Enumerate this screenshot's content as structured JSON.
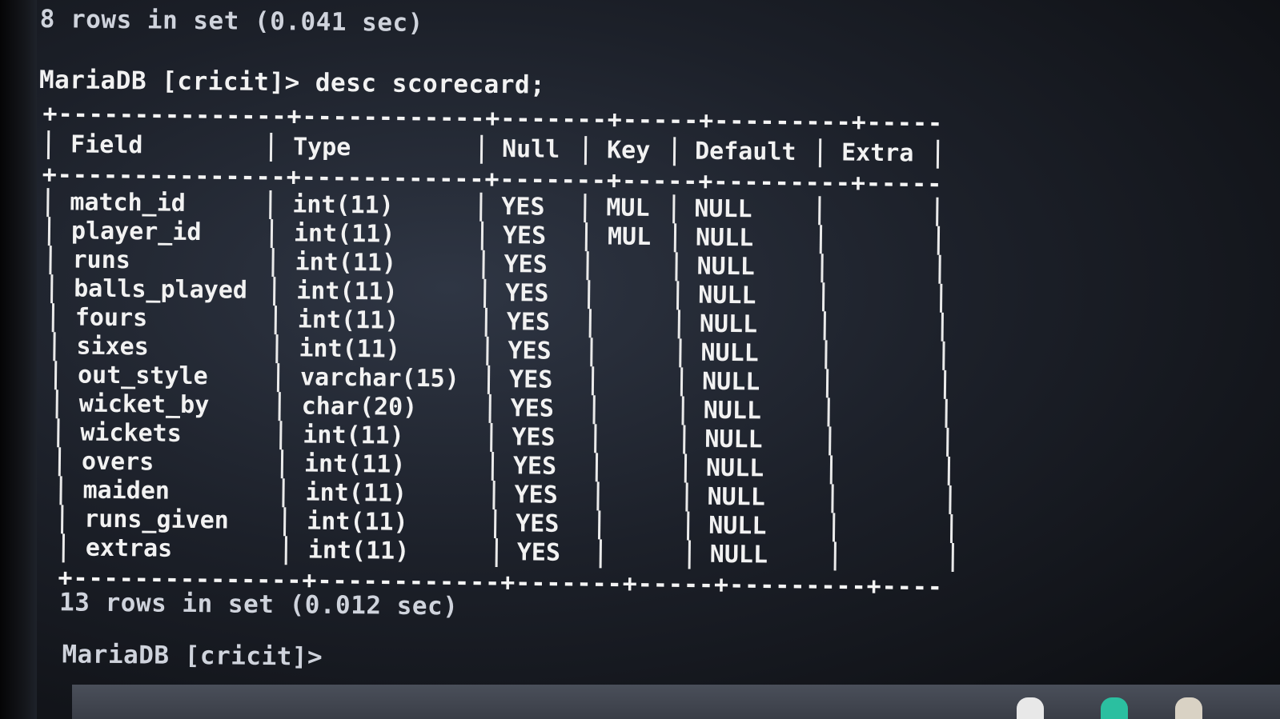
{
  "terminal": {
    "prev_result": "8 rows in set (0.041 sec)",
    "prompt_command": "MariaDB [cricit]> desc scorecard;",
    "border_line": "+---------------+------------+-------+-----+---------+-------+",
    "columns": [
      "Field",
      "Type",
      "Null",
      "Key",
      "Default",
      "Extra"
    ],
    "rows": [
      [
        "match_id",
        "int(11)",
        "YES",
        "MUL",
        "NULL",
        ""
      ],
      [
        "player_id",
        "int(11)",
        "YES",
        "MUL",
        "NULL",
        ""
      ],
      [
        "runs",
        "int(11)",
        "YES",
        "",
        "NULL",
        ""
      ],
      [
        "balls_played",
        "int(11)",
        "YES",
        "",
        "NULL",
        ""
      ],
      [
        "fours",
        "int(11)",
        "YES",
        "",
        "NULL",
        ""
      ],
      [
        "sixes",
        "int(11)",
        "YES",
        "",
        "NULL",
        ""
      ],
      [
        "out_style",
        "varchar(15)",
        "YES",
        "",
        "NULL",
        ""
      ],
      [
        "wicket_by",
        "char(20)",
        "YES",
        "",
        "NULL",
        ""
      ],
      [
        "wickets",
        "int(11)",
        "YES",
        "",
        "NULL",
        ""
      ],
      [
        "overs",
        "int(11)",
        "YES",
        "",
        "NULL",
        ""
      ],
      [
        "maiden",
        "int(11)",
        "YES",
        "",
        "NULL",
        ""
      ],
      [
        "runs_given",
        "int(11)",
        "YES",
        "",
        "NULL",
        ""
      ],
      [
        "extras",
        "int(11)",
        "YES",
        "",
        "NULL",
        ""
      ]
    ],
    "result": "13 rows in set (0.012 sec)",
    "prompt": "MariaDB [cricit]>"
  },
  "taskbar": {
    "icons": [
      "taskbar-app-icon-1",
      "taskbar-app-icon-2",
      "taskbar-app-icon-3"
    ],
    "colors": [
      "#e8e8e8",
      "#2bbfa0",
      "#d9d2c4"
    ]
  }
}
